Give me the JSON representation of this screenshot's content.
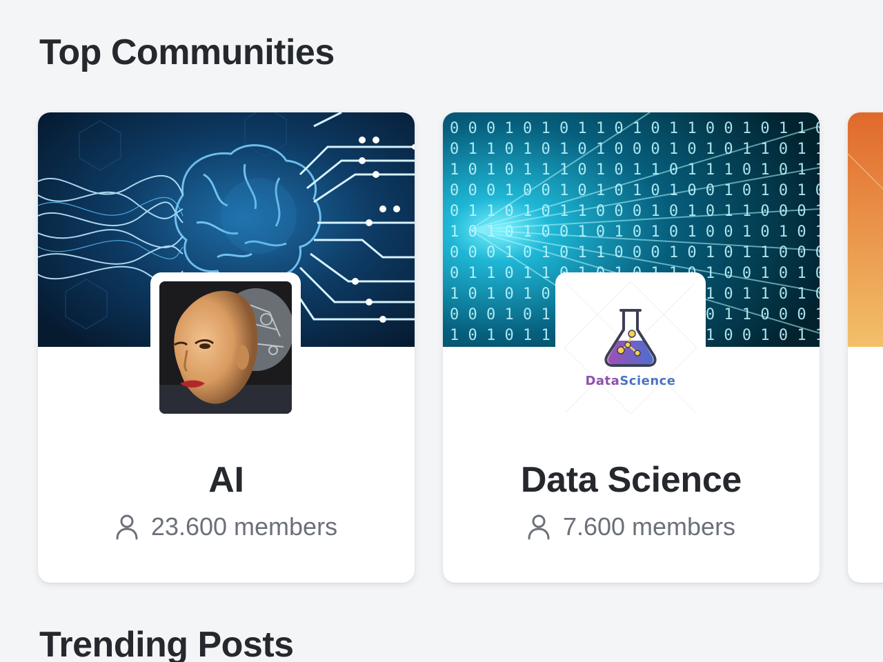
{
  "sections": {
    "top_communities": "Top Communities",
    "trending_posts": "Trending Posts"
  },
  "communities": [
    {
      "name": "AI",
      "members": "23.600 members",
      "banner": "circuit-brain-banner",
      "avatar": "humanoid-robot-face"
    },
    {
      "name": "Data Science",
      "members": "7.600 members",
      "banner": "binary-code-banner",
      "avatar": "datascience-flask-logo",
      "logo_text_1": "Data",
      "logo_text_2": "Science"
    }
  ],
  "colors": {
    "background": "#f4f5f7",
    "card": "#ffffff",
    "title": "#25282d",
    "muted": "#6b7079",
    "peek_gradient_top": "#e0692c",
    "peek_gradient_bottom": "#f3c06a",
    "logo_purple": "#8e4fb0",
    "logo_blue": "#4a74c4"
  }
}
